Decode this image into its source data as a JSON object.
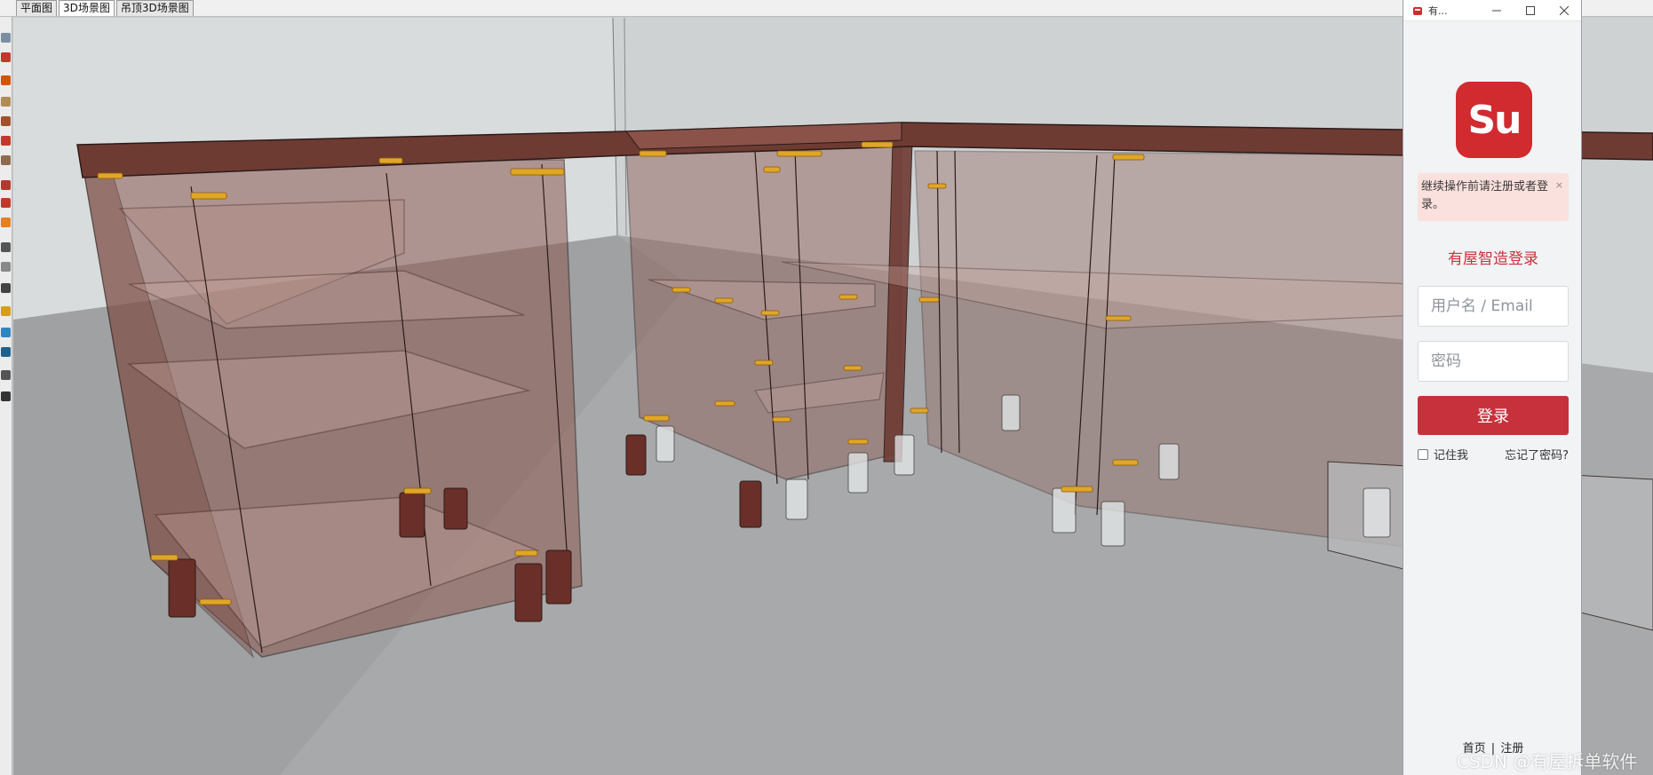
{
  "scene_tabs": [
    {
      "label": "平面图",
      "active": false
    },
    {
      "label": "3D场景图",
      "active": true
    },
    {
      "label": "吊顶3D场景图",
      "active": false
    }
  ],
  "tool_palette": {
    "tools": [
      "orbit-icon",
      "pencil-icon",
      "line-icon",
      "rectangle-icon",
      "circle-icon",
      "arc-icon",
      "push-pull-icon",
      "move-icon",
      "paint-bucket-icon",
      "eraser-icon",
      "tape-measure-icon",
      "text-icon",
      "dimension-icon",
      "protractor-icon",
      "pan-icon",
      "zoom-icon",
      "walk-icon",
      "section-icon"
    ]
  },
  "login_window": {
    "title": "有...",
    "controls": [
      "minimize-icon",
      "maximize-icon",
      "close-icon"
    ],
    "logo_text": "Su",
    "notice": "继续操作前请注册或者登录。",
    "notice_close": "×",
    "heading": "有屋智造登录",
    "username_placeholder": "用户名 / Email",
    "password_placeholder": "密码",
    "login_button": "登录",
    "remember_label": "记住我",
    "forgot_label": "忘记了密码?",
    "footer_home": "首页",
    "footer_sep": "|",
    "footer_register": "注册"
  },
  "watermark": "CSDN @有屋拆单软件",
  "colors": {
    "accent_red": "#c7313c",
    "logo_red": "#d12a2f",
    "notice_bg": "#fbe1dd",
    "countertop": "#6e3b33",
    "cabinet_tint": "#8b5a52",
    "hardware": "#e0a628"
  }
}
